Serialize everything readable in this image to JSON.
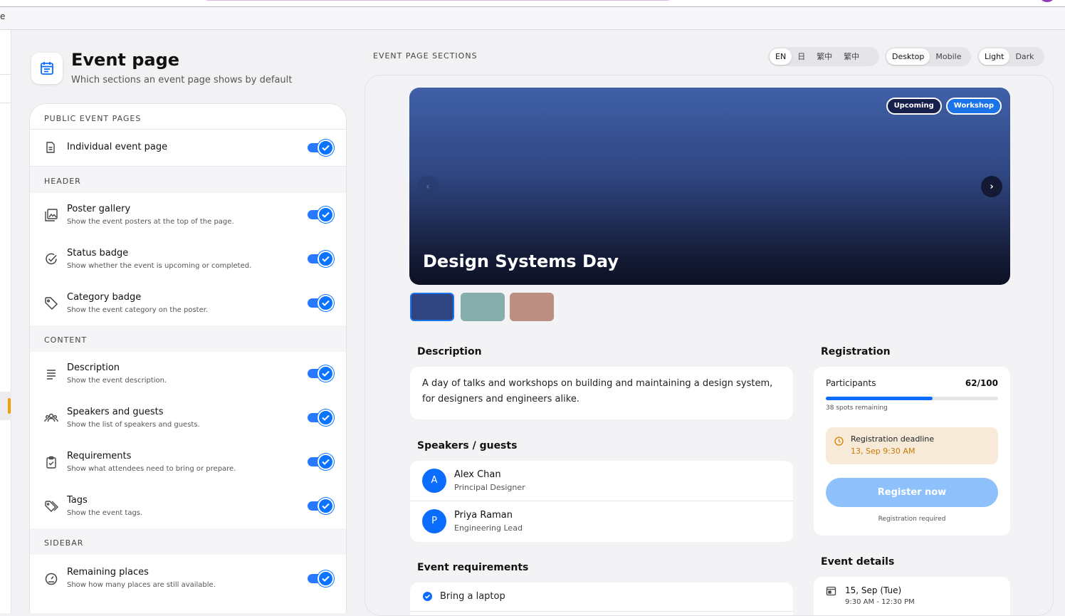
{
  "browser": {
    "edge_text": "e"
  },
  "header": {
    "title": "Event page",
    "subtitle": "Which sections an event page shows by default"
  },
  "settings": {
    "public_label": "PUBLIC EVENT PAGES",
    "individual": {
      "title": "Individual event page",
      "enabled": true
    },
    "header_label": "HEADER",
    "header_items": [
      {
        "title": "Poster gallery",
        "desc": "Show the event posters at the top of the page.",
        "icon": "image-gallery-icon",
        "enabled": true
      },
      {
        "title": "Status badge",
        "desc": "Show whether the event is upcoming or completed.",
        "icon": "check-circle-icon",
        "enabled": true
      },
      {
        "title": "Category badge",
        "desc": "Show the event category on the poster.",
        "icon": "tag-icon",
        "enabled": true
      }
    ],
    "content_label": "CONTENT",
    "content_items": [
      {
        "title": "Description",
        "desc": "Show the event description.",
        "icon": "text-lines-icon",
        "enabled": true
      },
      {
        "title": "Speakers and guests",
        "desc": "Show the list of speakers and guests.",
        "icon": "people-icon",
        "enabled": true
      },
      {
        "title": "Requirements",
        "desc": "Show what attendees need to bring or prepare.",
        "icon": "clipboard-check-icon",
        "enabled": true
      },
      {
        "title": "Tags",
        "desc": "Show the event tags.",
        "icon": "tags-icon",
        "enabled": true
      }
    ],
    "sidebar_label": "SIDEBAR",
    "sidebar_items": [
      {
        "title": "Remaining places",
        "desc": "Show how many places are still available.",
        "icon": "gauge-icon",
        "enabled": true
      }
    ]
  },
  "preview_header": {
    "label": "EVENT PAGE SECTIONS",
    "languages": [
      "EN",
      "日",
      "繁中",
      "繁中"
    ],
    "selected_language": "EN",
    "devices": [
      "Desktop",
      "Mobile"
    ],
    "selected_device": "Desktop",
    "themes": [
      "Light",
      "Dark"
    ],
    "selected_theme": "Light"
  },
  "preview": {
    "hero": {
      "title": "Design Systems Day",
      "status_badge": "Upcoming",
      "category_badge": "Workshop",
      "prev_arrow": "‹",
      "next_arrow": "›"
    },
    "thumbnails": [
      "#2f4582",
      "#86aeaa",
      "#bb8f83"
    ],
    "description": {
      "heading": "Description",
      "text": "A day of talks and workshops on building and maintaining a design system, for designers and engineers alike."
    },
    "speakers": {
      "heading": "Speakers / guests",
      "items": [
        {
          "initial": "A",
          "name": "Alex Chan",
          "role": "Principal Designer"
        },
        {
          "initial": "P",
          "name": "Priya Raman",
          "role": "Engineering Lead"
        }
      ]
    },
    "requirements": {
      "heading": "Event requirements",
      "items": [
        "Bring a laptop"
      ]
    },
    "registration": {
      "heading": "Registration",
      "participants_label": "Participants",
      "participants_value": "62/100",
      "fill_fraction": 0.62,
      "remaining": "38 spots remaining",
      "deadline_label": "Registration deadline",
      "deadline_value": "13, Sep 9:30 AM",
      "register_button": "Register now",
      "note": "Registration required"
    },
    "details": {
      "heading": "Event details",
      "date": "15, Sep (Tue)",
      "time": "9:30 AM - 12:30 PM"
    }
  },
  "colors": {
    "accent": "#0a6dff",
    "deadline_text": "#c77a00",
    "deadline_bg": "#f7ead9"
  }
}
